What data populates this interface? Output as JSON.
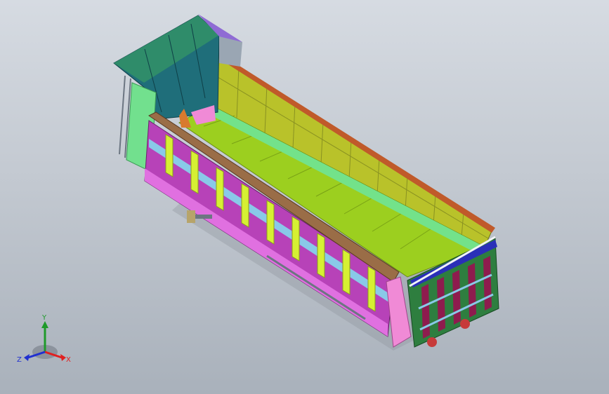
{
  "viewport": {
    "background_top": "#d6dbe2",
    "background_bottom": "#a9b1bb"
  },
  "model": {
    "colors": {
      "bed_floor": "#9ccf1f",
      "far_wall": "#b9c22a",
      "near_wall_rail": "#9a6d47",
      "near_wall_body": "#b742b8",
      "stakes": "#d6f033",
      "stripe": "#89c9e8",
      "front_head_board": "#2f8c6a",
      "front_side_panel": "#72e08e",
      "cab_shield": "#1f6e7a",
      "purple_top": "#8f6bd4",
      "pink_parts": "#f08ad6",
      "rear_frame": "#2e7e3f",
      "rear_bars": "#8e1c4e",
      "rear_blue": "#2a2fb8",
      "wheels": "#c73a3a"
    }
  },
  "triad": {
    "x_label": "X",
    "y_label": "Y",
    "z_label": "Z",
    "x_color": "#e02020",
    "y_color": "#1f9a2a",
    "z_color": "#2030d0"
  }
}
